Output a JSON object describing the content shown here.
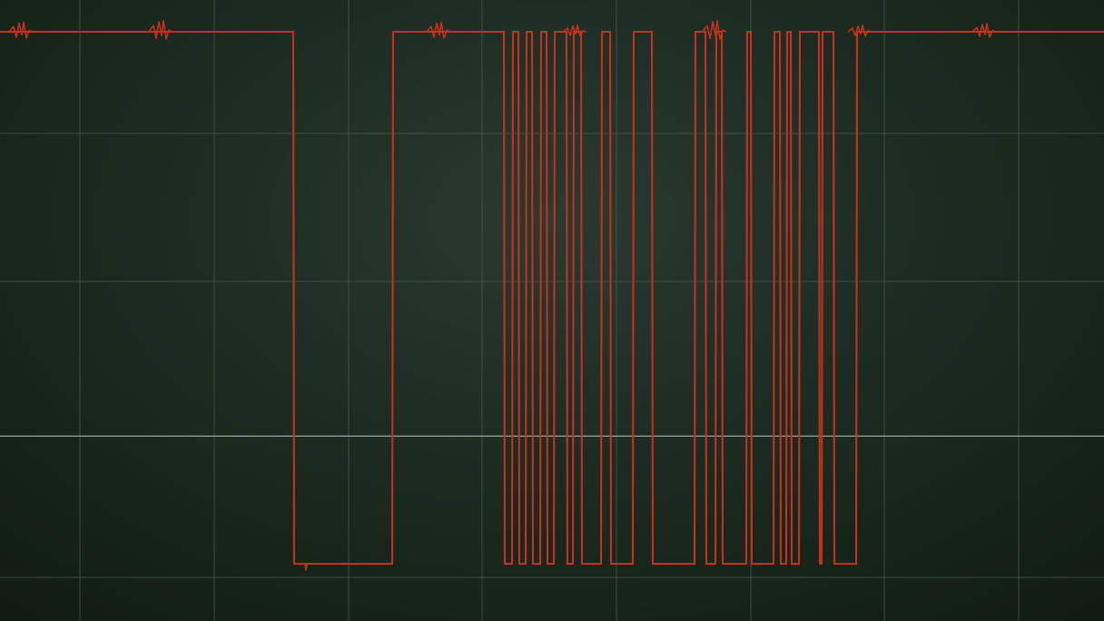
{
  "chart_data": {
    "type": "line",
    "title": "",
    "xlabel": "",
    "ylabel": "",
    "xlim": [
      0,
      1216
    ],
    "ylim": [
      0,
      1
    ],
    "grid": true,
    "zero_reference": 0.24,
    "high_level": 1.0,
    "low_level": 0.0,
    "color": "#c5311c",
    "series": [
      {
        "transitions": [
          [
            0,
            1
          ],
          [
            323,
            0
          ],
          [
            432,
            1
          ],
          [
            555,
            0
          ],
          [
            564,
            1
          ],
          [
            571,
            0
          ],
          [
            579,
            1
          ],
          [
            586,
            0
          ],
          [
            595,
            1
          ],
          [
            602,
            0
          ],
          [
            610,
            1
          ],
          [
            624,
            0
          ],
          [
            631,
            1
          ],
          [
            640,
            0
          ],
          [
            662,
            1
          ],
          [
            672,
            0
          ],
          [
            697,
            1
          ],
          [
            718,
            0
          ],
          [
            765,
            1
          ],
          [
            777,
            0
          ],
          [
            788,
            1
          ],
          [
            795,
            0
          ],
          [
            822,
            1
          ],
          [
            827,
            0
          ],
          [
            852,
            1
          ],
          [
            859,
            0
          ],
          [
            866,
            1
          ],
          [
            871,
            0
          ],
          [
            880,
            1
          ],
          [
            902,
            0
          ],
          [
            905,
            1
          ],
          [
            918,
            0
          ],
          [
            943,
            1
          ]
        ],
        "end_x": 1216
      }
    ],
    "noise_bursts": [
      {
        "x": 24,
        "amplitude": 0.03
      },
      {
        "x": 178,
        "amplitude": 0.035
      },
      {
        "x": 484,
        "amplitude": 0.03
      },
      {
        "x": 634,
        "amplitude": 0.02
      },
      {
        "x": 788,
        "amplitude": 0.035
      },
      {
        "x": 948,
        "amplitude": 0.02
      },
      {
        "x": 1085,
        "amplitude": 0.025
      }
    ],
    "low_glitch_x": 337
  }
}
